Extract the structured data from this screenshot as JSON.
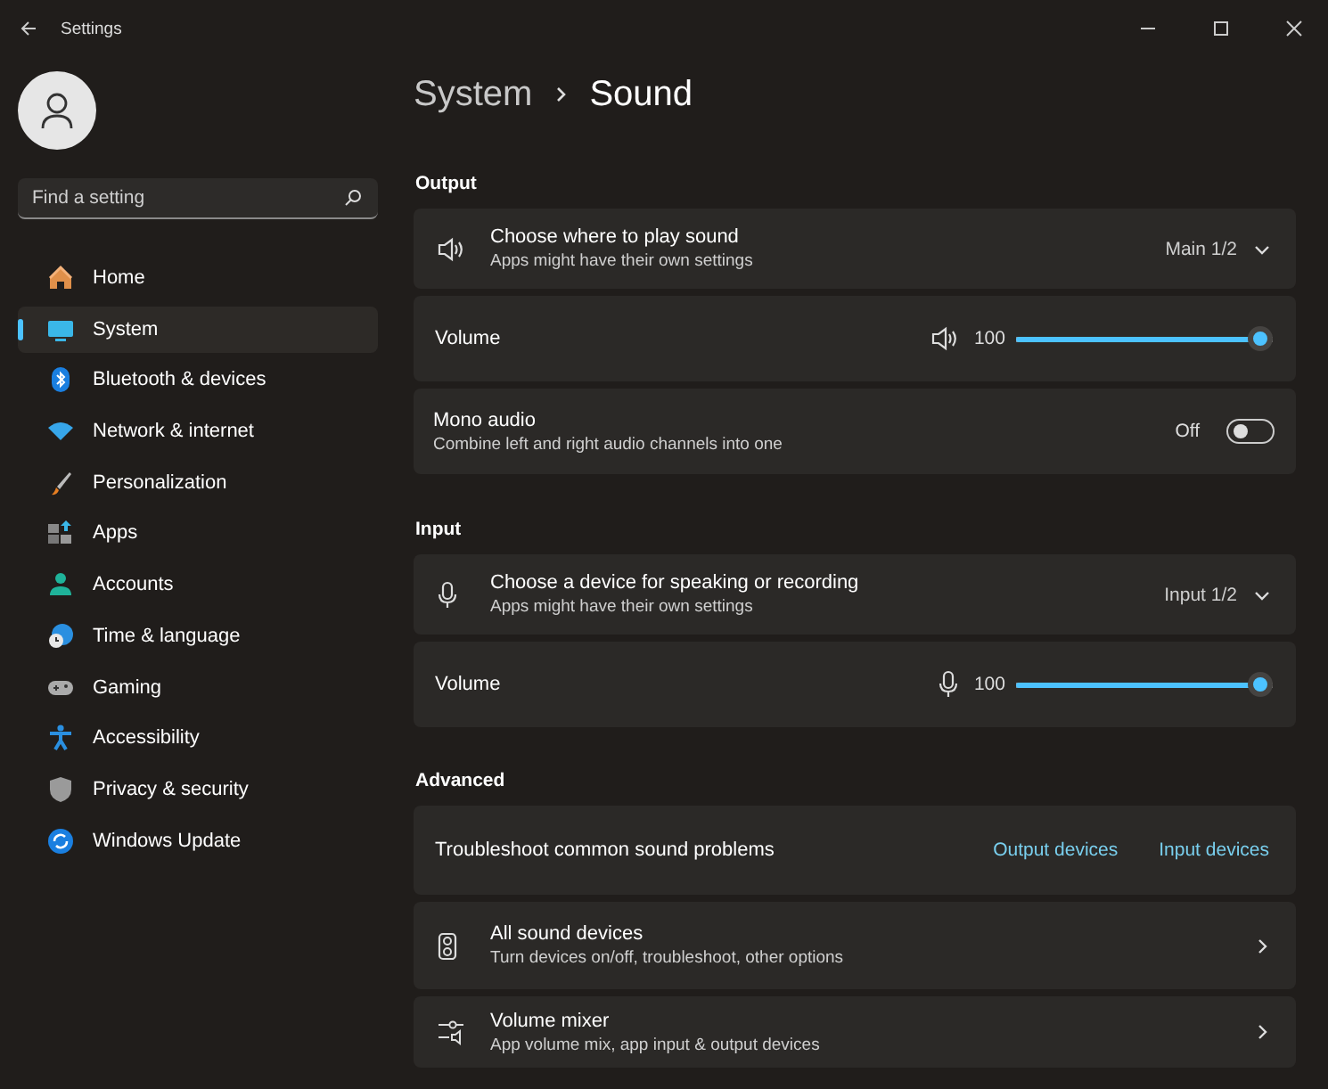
{
  "window": {
    "title": "Settings"
  },
  "sidebar": {
    "search": {
      "placeholder": "Find a setting"
    },
    "items": [
      {
        "label": "Home",
        "selected": false
      },
      {
        "label": "System",
        "selected": true
      },
      {
        "label": "Bluetooth & devices",
        "selected": false
      },
      {
        "label": "Network & internet",
        "selected": false
      },
      {
        "label": "Personalization",
        "selected": false
      },
      {
        "label": "Apps",
        "selected": false
      },
      {
        "label": "Accounts",
        "selected": false
      },
      {
        "label": "Time & language",
        "selected": false
      },
      {
        "label": "Gaming",
        "selected": false
      },
      {
        "label": "Accessibility",
        "selected": false
      },
      {
        "label": "Privacy & security",
        "selected": false
      },
      {
        "label": "Windows Update",
        "selected": false
      }
    ]
  },
  "breadcrumb": {
    "parent": "System",
    "current": "Sound"
  },
  "sections": [
    {
      "heading": "Output",
      "cards": [
        {
          "kind": "select",
          "title": "Choose where to play sound",
          "subtitle": "Apps might have their own settings",
          "value": "Main 1/2"
        },
        {
          "kind": "slider",
          "label": "Volume",
          "reading": "100",
          "level": 1.0
        },
        {
          "kind": "toggle",
          "title": "Mono audio",
          "subtitle": "Combine left and right audio channels into one",
          "state_label": "Off",
          "on": false
        }
      ]
    },
    {
      "heading": "Input",
      "cards": [
        {
          "kind": "select",
          "title": "Choose a device for speaking or recording",
          "subtitle": "Apps might have their own settings",
          "value": "Input 1/2"
        },
        {
          "kind": "slider",
          "label": "Volume",
          "reading": "100",
          "level": 1.0
        }
      ]
    },
    {
      "heading": "Advanced",
      "cards": [
        {
          "kind": "links",
          "label": "Troubleshoot common sound problems",
          "links": [
            "Output devices",
            "Input devices"
          ]
        },
        {
          "kind": "nav",
          "title": "All sound devices",
          "subtitle": "Turn devices on/off, troubleshoot, other options"
        },
        {
          "kind": "nav",
          "title": "Volume mixer",
          "subtitle": "App volume mix, app input & output devices"
        }
      ]
    }
  ]
}
